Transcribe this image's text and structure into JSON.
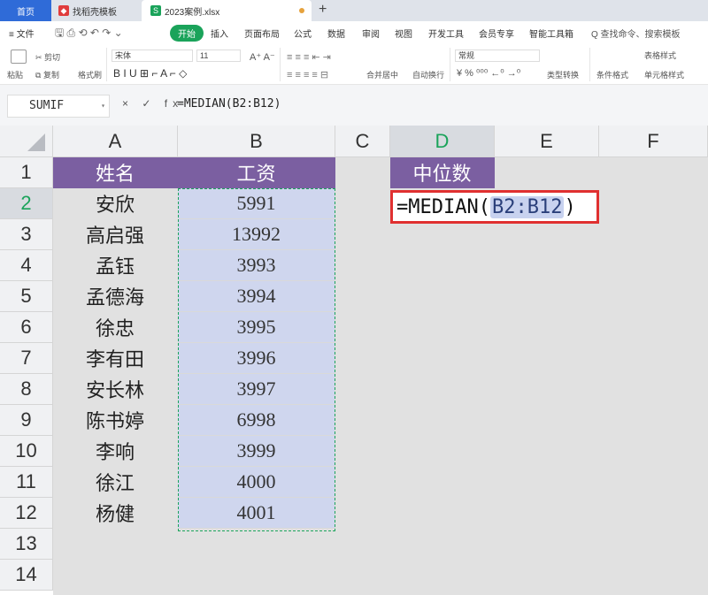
{
  "tabs": {
    "home": "首页",
    "template": "找稻壳模板",
    "file": "2023案例.xlsx",
    "file_icon": "S",
    "add": "+"
  },
  "menu": {
    "file": "≡ 文件",
    "start": "开始",
    "insert": "插入",
    "layout": "页面布局",
    "formula": "公式",
    "data": "数据",
    "review": "审阅",
    "view": "视图",
    "dev": "开发工具",
    "member": "会员专享",
    "smart": "智能工具箱",
    "search": "Q 查找命令、搜索模板"
  },
  "ribbon": {
    "cut": "剪切",
    "paste": "粘贴",
    "copy": "复制",
    "format_painter": "格式刷",
    "font": "宋体",
    "font_size": "11",
    "merge": "合并居中",
    "wrap": "自动换行",
    "number_format": "常规",
    "type_convert": "类型转换",
    "cond_format": "条件格式",
    "table_style": "表格样式",
    "cell_style": "单元格样式"
  },
  "formula_bar": {
    "name_box": "SUMIF",
    "icons": "× ✓ fx",
    "content": "=MEDIAN(B2:B12)"
  },
  "columns": [
    "A",
    "B",
    "C",
    "D",
    "E",
    "F"
  ],
  "active_column": "D",
  "rows": [
    "1",
    "2",
    "3",
    "4",
    "5",
    "6",
    "7",
    "8",
    "9",
    "10",
    "11",
    "12",
    "13",
    "14"
  ],
  "active_row": "2",
  "table": {
    "header_name": "姓名",
    "header_salary": "工资",
    "names": [
      "安欣",
      "高启强",
      "孟钰",
      "孟德海",
      "徐忠",
      "李有田",
      "安长林",
      "陈书婷",
      "李响",
      "徐江",
      "杨健"
    ],
    "salaries": [
      "5991",
      "13992",
      "3993",
      "3994",
      "3995",
      "3996",
      "3997",
      "6998",
      "3999",
      "4000",
      "4001"
    ]
  },
  "median": {
    "header": "中位数",
    "edit_prefix": "=MEDIAN(",
    "edit_ref": "B2:B12",
    "edit_suffix": ")"
  },
  "colors": {
    "header_fill": "#7b5fa1",
    "selection_fill": "#cfd6ee",
    "accent_green": "#1aa35a",
    "edit_border": "#e03030"
  }
}
